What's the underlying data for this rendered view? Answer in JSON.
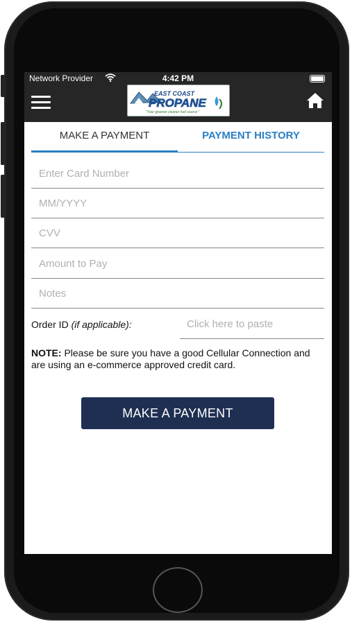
{
  "status_bar": {
    "provider": "Network Provider",
    "time": "4:42 PM"
  },
  "app_bar": {
    "logo_text_top": "EAST COAST",
    "logo_text_main": "PROPANE",
    "logo_tagline": "Your greener cleaner fuel source",
    "menu_icon": "hamburger-menu-icon",
    "home_icon": "home-icon"
  },
  "tabs": [
    {
      "label": "MAKE A PAYMENT",
      "active": true
    },
    {
      "label": "PAYMENT HISTORY",
      "active": false
    }
  ],
  "form": {
    "card_number_placeholder": "Enter Card Number",
    "expiry_placeholder": "MM/YYYY",
    "cvv_placeholder": "CVV",
    "amount_placeholder": "Amount to Pay",
    "notes_placeholder": "Notes",
    "order_label": "Order ID",
    "order_label_italic": "(if applicable):",
    "order_placeholder": "Click here to paste"
  },
  "note": {
    "prefix": "NOTE:",
    "text": " Please be sure you have a good Cellular Connection and are using an e-commerce approved credit card."
  },
  "submit_button": "MAKE A PAYMENT",
  "colors": {
    "accent": "#2a7fc5",
    "button": "#1e2f52",
    "appbar": "#262626"
  }
}
